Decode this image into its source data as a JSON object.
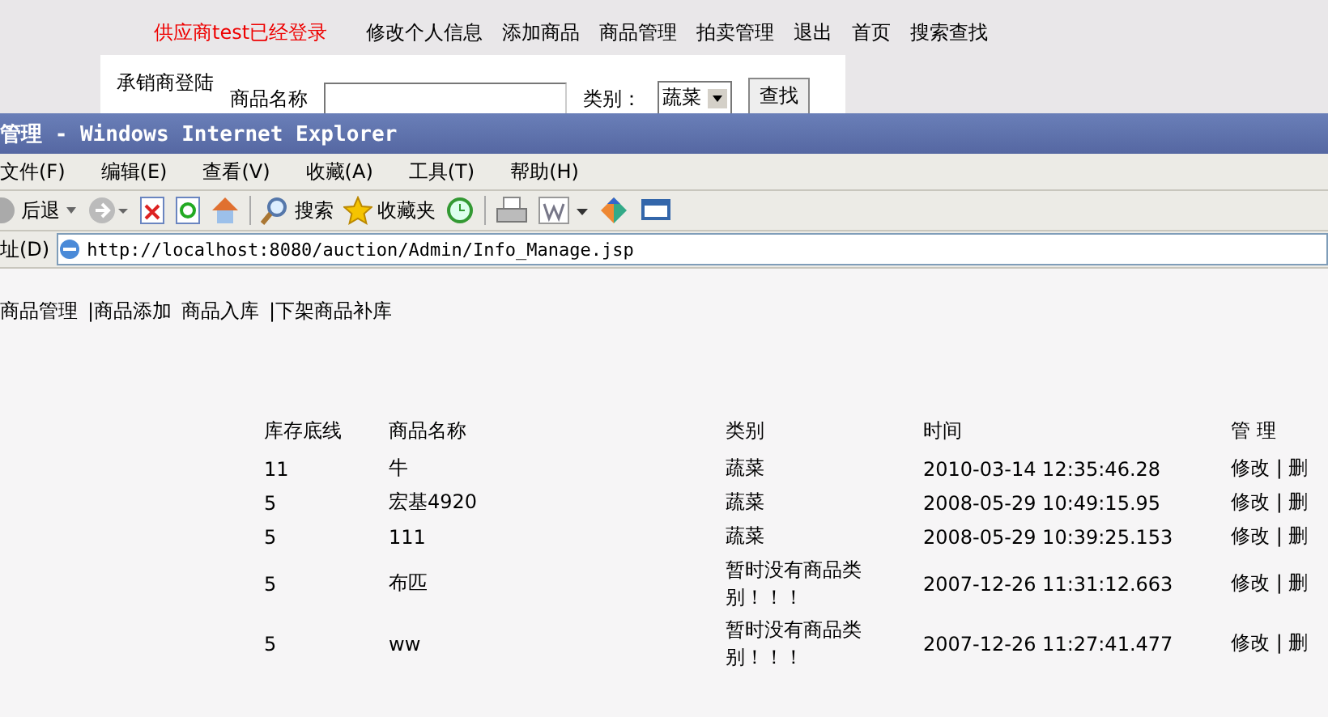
{
  "background_page": {
    "login_status": "供应商test已经登录",
    "nav_links": [
      "修改个人信息",
      "添加商品",
      "商品管理",
      "拍卖管理",
      "退出",
      "首页",
      "搜索查找"
    ],
    "search_panel": {
      "title": "承销商登陆",
      "name_label": "商品名称",
      "category_label": "类别：",
      "category_value": "蔬菜",
      "search_button": "查找"
    }
  },
  "browser": {
    "title": "管理 - Windows Internet Explorer",
    "menu": [
      "文件(F)",
      "编辑(E)",
      "查看(V)",
      "收藏(A)",
      "工具(T)",
      "帮助(H)"
    ],
    "toolbar": [
      {
        "kind": "back",
        "label": "后退"
      },
      {
        "kind": "forward"
      },
      {
        "kind": "stop"
      },
      {
        "kind": "refresh"
      },
      {
        "kind": "home"
      },
      {
        "kind": "separator"
      },
      {
        "kind": "search",
        "label": "搜索"
      },
      {
        "kind": "favorites",
        "label": "收藏夹"
      },
      {
        "kind": "history"
      },
      {
        "kind": "separator"
      },
      {
        "kind": "print"
      },
      {
        "kind": "edit"
      },
      {
        "kind": "messenger"
      },
      {
        "kind": "discuss"
      }
    ],
    "address_label": "址(D)",
    "url": "http://localhost:8080/auction/Admin/Info_Manage.jsp"
  },
  "page": {
    "links": [
      "商品管理",
      "|商品添加",
      "商品入库",
      "|下架商品补库"
    ],
    "table": {
      "columns": [
        "库存底线",
        "商品名称",
        "类别",
        "时间",
        "管 理"
      ],
      "rows": [
        {
          "stock": "11",
          "name": "牛",
          "category": "蔬菜",
          "time": "2010-03-14 12:35:46.28",
          "actions": "修改 | 删"
        },
        {
          "stock": "5",
          "name": "宏基4920",
          "category": "蔬菜",
          "time": "2008-05-29 10:49:15.95",
          "actions": "修改 | 删"
        },
        {
          "stock": "5",
          "name": "111",
          "category": "蔬菜",
          "time": "2008-05-29 10:39:25.153",
          "actions": "修改 | 删"
        },
        {
          "stock": "5",
          "name": "布匹",
          "category": "暂时没有商品类别！！！",
          "time": "2007-12-26 11:31:12.663",
          "actions": "修改 | 删"
        },
        {
          "stock": "5",
          "name": "ww",
          "category": "暂时没有商品类别！！！",
          "time": "2007-12-26 11:27:41.477",
          "actions": "修改 | 删"
        }
      ]
    }
  }
}
